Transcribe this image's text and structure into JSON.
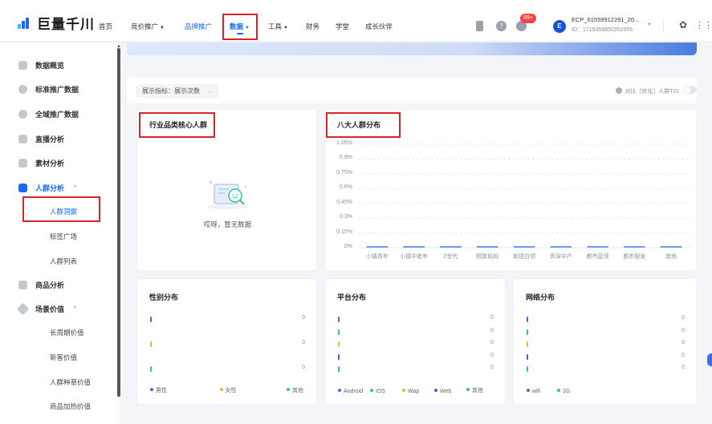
{
  "header": {
    "logo_text": "巨量千川",
    "nav": [
      {
        "label": "首页",
        "has_caret": false
      },
      {
        "label": "竞价推广",
        "has_caret": true
      },
      {
        "label": "品牌推广",
        "has_caret": false
      },
      {
        "label": "数据",
        "has_caret": true,
        "active": true
      },
      {
        "label": "工具",
        "has_caret": true
      },
      {
        "label": "财务",
        "has_caret": false
      },
      {
        "label": "学堂",
        "has_caret": false
      },
      {
        "label": "成长伙伴",
        "has_caret": false
      }
    ],
    "caret": "▼",
    "help_icon_glyph": "?",
    "badge": "99+",
    "avatar_letter": "E",
    "account_name": "ECP_61559912291_20...",
    "account_id": "ID：1719359850352655",
    "highlight_color": "#d9232a",
    "accent_color": "#1a66ff"
  },
  "sidebar": {
    "items": [
      {
        "label": "数据概览"
      },
      {
        "label": "标准推广数据"
      },
      {
        "label": "全域推广数据"
      },
      {
        "label": "直播分析"
      },
      {
        "label": "素材分析"
      },
      {
        "label": "人群分析",
        "expanded": true,
        "active": true
      },
      {
        "label": "商品分析"
      },
      {
        "label": "场景价值",
        "expanded": true
      }
    ],
    "sub_people": [
      "人群洞察",
      "标签广场",
      "人群列表"
    ],
    "sub_scene": [
      "长周期价值",
      "新客价值",
      "人群种草价值",
      "商品加热价值"
    ],
    "expand_arrow": "^"
  },
  "filter": {
    "select_label": "展示指标：展示次数",
    "compare_label": "对比［转化］人群TGI"
  },
  "industry_card": {
    "title": "行业品类核心人群",
    "empty_text": "哎呀，暂无数据"
  },
  "eight_card": {
    "title": "八大人群分布",
    "chart_data": {
      "type": "bar",
      "categories": [
        "小镇青年",
        "小镇中老年",
        "Z世代",
        "精致妈妈",
        "新锐白领",
        "资深中产",
        "都市蓝领",
        "都市银发",
        "其他"
      ],
      "values": [
        0,
        0,
        0,
        0,
        0,
        0,
        0,
        0,
        0
      ],
      "y_ticks": [
        "0%",
        "0.15%",
        "0.3%",
        "0.45%",
        "0.6%",
        "0.75%",
        "0.9%",
        "1.05%"
      ],
      "ylim": [
        0,
        1.05
      ],
      "grid": true,
      "bar_color": "#6f9bf2"
    }
  },
  "gender_card": {
    "title": "性别分布",
    "rows": [
      {
        "value": "0",
        "color": "#3a6ee8"
      },
      {
        "value": "0",
        "color": "#f2b233"
      },
      {
        "value": "0",
        "color": "#2ec2a0"
      }
    ],
    "legend": [
      {
        "label": "男性",
        "color": "#3a6ee8"
      },
      {
        "label": "女性",
        "color": "#f2b233"
      },
      {
        "label": "其他",
        "color": "#2ec2a0"
      }
    ]
  },
  "platform_card": {
    "title": "平台分布",
    "rows": [
      {
        "value": "0",
        "color": "#3a6ee8"
      },
      {
        "value": "0",
        "color": "#2ec2a0"
      },
      {
        "value": "0",
        "color": "#f2b233"
      },
      {
        "value": "0",
        "color": "#5b4de0"
      },
      {
        "value": "0",
        "color": "#2ec2a0"
      }
    ],
    "legend": [
      {
        "label": "Android",
        "color": "#3a6ee8"
      },
      {
        "label": "IOS",
        "color": "#2ec2a0"
      },
      {
        "label": "Wap",
        "color": "#f2b233"
      },
      {
        "label": "Web",
        "color": "#5b4de0"
      },
      {
        "label": "其他",
        "color": "#2ec2a0"
      }
    ]
  },
  "network_card": {
    "title": "网络分布",
    "rows": [
      {
        "value": "0",
        "color": "#3a6ee8"
      },
      {
        "value": "0",
        "color": "#2ec2a0"
      },
      {
        "value": "0",
        "color": "#f2b233"
      },
      {
        "value": "0",
        "color": "#5b4de0"
      },
      {
        "value": "0",
        "color": "#2ec2a0"
      }
    ],
    "legend": [
      {
        "label": "wifi",
        "color": "#3a6ee8"
      },
      {
        "label": "2G",
        "color": "#2ec2a0"
      }
    ]
  }
}
